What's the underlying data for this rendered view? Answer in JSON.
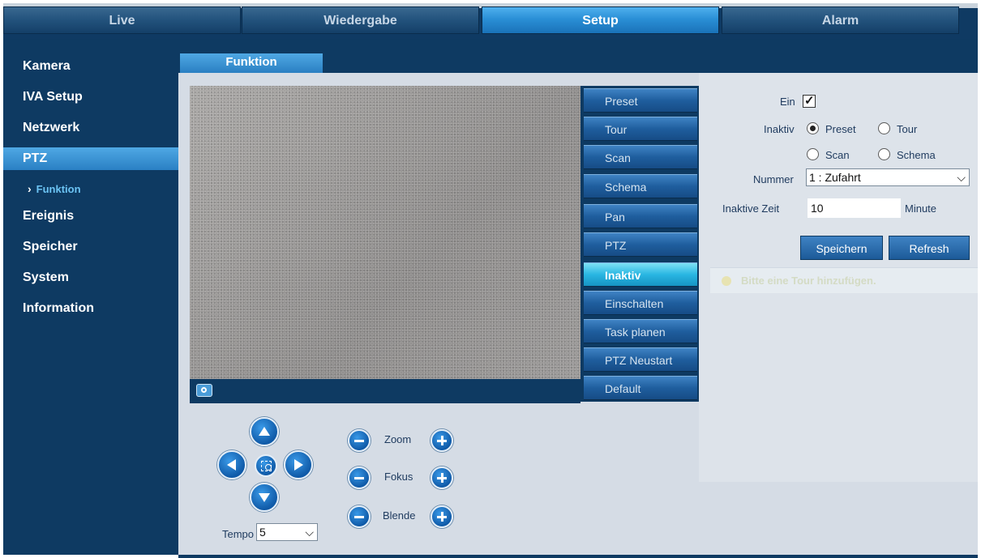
{
  "topnav": {
    "tabs": [
      "Live",
      "Wiedergabe",
      "Setup",
      "Alarm"
    ],
    "active": "Setup"
  },
  "sidebar": {
    "items": [
      "Kamera",
      "IVA Setup",
      "Netzwerk",
      "PTZ",
      "Ereignis",
      "Speicher",
      "System",
      "Information"
    ],
    "active": "PTZ",
    "sub_item": "Funktion"
  },
  "main": {
    "tab": "Funktion"
  },
  "function_buttons": {
    "items": [
      "Preset",
      "Tour",
      "Scan",
      "Schema",
      "Pan",
      "PTZ",
      "Inaktiv",
      "Einschalten",
      "Task planen",
      "PTZ Neustart",
      "Default"
    ],
    "active": "Inaktiv"
  },
  "settings": {
    "ein_label": "Ein",
    "ein_checked": true,
    "inaktiv_label": "Inaktiv",
    "radio_options": [
      "Preset",
      "Tour",
      "Scan",
      "Schema"
    ],
    "radio_selected": "Preset",
    "nummer_label": "Nummer",
    "nummer_value": "1 : Zufahrt",
    "inaktive_zeit_label": "Inaktive Zeit",
    "inaktive_zeit_value": "10",
    "unit": "Minute",
    "save_label": "Speichern",
    "refresh_label": "Refresh",
    "hint": "Bitte eine Tour hinzufügen."
  },
  "ptz_controls": {
    "zoom_label": "Zoom",
    "fokus_label": "Fokus",
    "blende_label": "Blende",
    "tempo_label": "Tempo",
    "tempo_value": "5"
  }
}
